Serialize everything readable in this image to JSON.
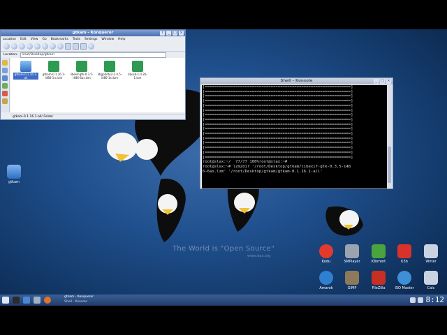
{
  "desktop": {
    "watermark": "The World is \"Open Source\"",
    "watermark_url": "www.slax.org",
    "left_icon": {
      "label": "gtkam",
      "icon": "folder-icon"
    },
    "apps": [
      {
        "label": "Kodu",
        "icon": "kodu-icon",
        "color": "#e23b2e"
      },
      {
        "label": "SMPlayer",
        "icon": "smplayer-icon",
        "color": "#9aa3b0"
      },
      {
        "label": "KTorrent",
        "icon": "ktorrent-icon",
        "color": "#4aa33c"
      },
      {
        "label": "K3b",
        "icon": "k3b-icon",
        "color": "#d9322a"
      },
      {
        "label": "Writer",
        "icon": "writer-icon",
        "color": "#c9d3e2"
      },
      {
        "label": "Amarok",
        "icon": "amarok-icon",
        "color": "#2f80d1"
      },
      {
        "label": "GIMP",
        "icon": "gimp-icon",
        "color": "#8e7a5a"
      },
      {
        "label": "FileZilla",
        "icon": "filezilla-icon",
        "color": "#c72f25"
      },
      {
        "label": "ISO Master",
        "icon": "iso-master-icon",
        "color": "#3f8fd6"
      },
      {
        "label": "Calc",
        "icon": "calc-icon",
        "color": "#c9d3e2"
      }
    ]
  },
  "konqueror": {
    "title": "gtkam - Konqueror",
    "menu": [
      "Location",
      "Edit",
      "View",
      "Go",
      "Bookmarks",
      "Tools",
      "Settings",
      "Window",
      "Help"
    ],
    "location_label": "Location:",
    "location_value": "/root/Desktop/gtkam",
    "files": [
      {
        "name": "gtkam-0.1.16.1-all",
        "selected": true,
        "icon": "folder-icon"
      },
      {
        "name": "gtkam-0.1.16.1-i486-1rc.lzm",
        "selected": false,
        "icon": "lzm-package-icon"
      },
      {
        "name": "libexif-gtk-0.3.5-i486-6as.lzm",
        "selected": false,
        "icon": "lzm-package-icon"
      },
      {
        "name": "libgphoto2-2.4.5-i486-1sl.lzm",
        "selected": false,
        "icon": "lzm-package-icon"
      },
      {
        "name": "libusb-1.0.2b-1.lzm",
        "selected": false,
        "icon": "lzm-package-icon"
      }
    ],
    "status": "gtkam-0.1.16.1-all/  Folder"
  },
  "terminal": {
    "title": "Shell - Konsole",
    "progress_lines": 16,
    "lines": [
      "root@slax:~/  77/77 100%root@slax:~#",
      "root@slax:~# lzm2dir '/root/Desktop/gtkam/libexif-gtk-0.3.5-i48",
      "6-6as.lzm' '/root/Desktop/gtkam/gtkam-0.1.16.1-all'"
    ]
  },
  "taskbar": {
    "tasks": [
      "gtkam - Konqueror",
      "Shell - Konsole"
    ],
    "clock": "8:12",
    "colors": {
      "accent": "#2b4f86"
    }
  }
}
